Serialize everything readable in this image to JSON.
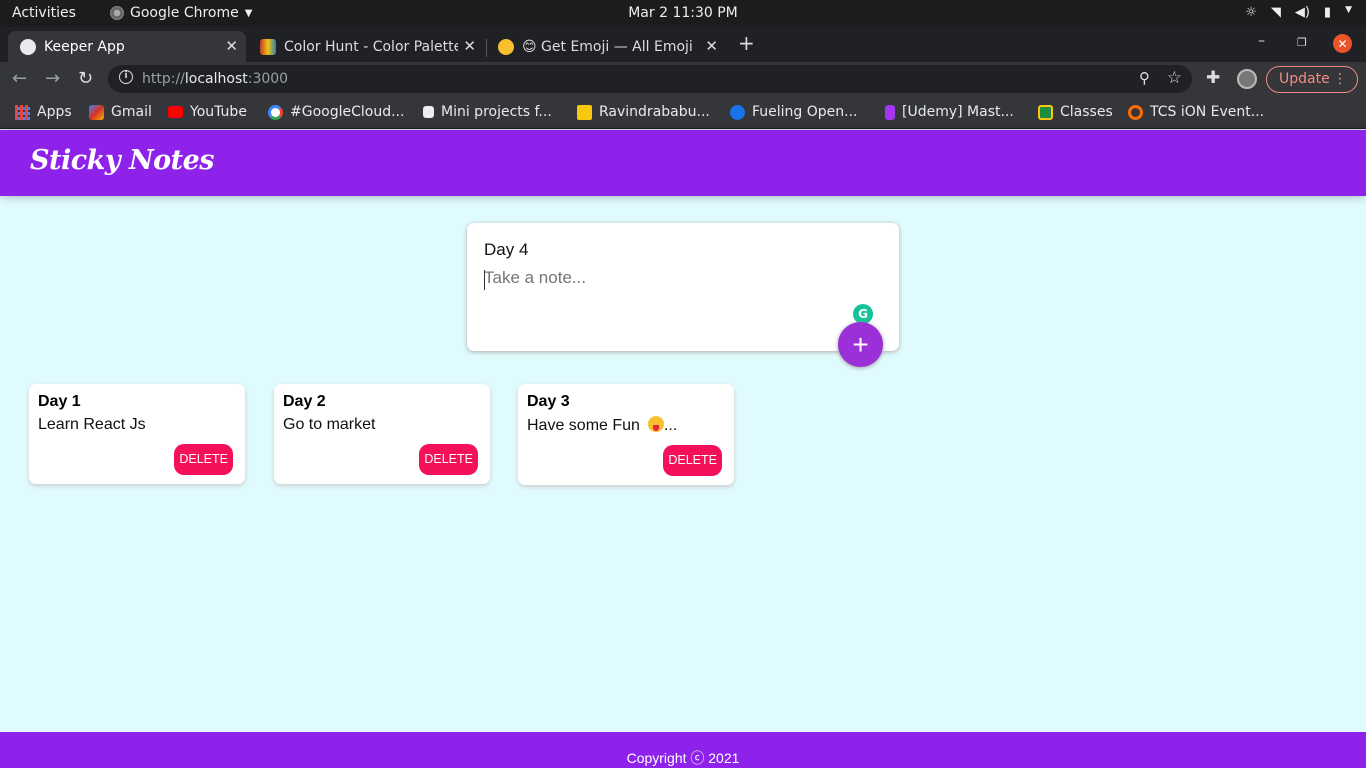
{
  "system": {
    "activities": "Activities",
    "app_name": "Google Chrome",
    "clock": "Mar 2  11:30 PM"
  },
  "tabs": [
    {
      "label": "Keeper App",
      "active": true
    },
    {
      "label": "Color Hunt - Color Palette",
      "active": false
    },
    {
      "label": "😊 Get Emoji — All Emojis",
      "active": false
    }
  ],
  "omnibox": {
    "url_prefix": "http://",
    "url_host": "localhost",
    "url_port": ":3000"
  },
  "update_label": "Update",
  "bookmarks": [
    {
      "label": "Apps",
      "color": "#e8453c"
    },
    {
      "label": "Gmail",
      "color": "#d93025"
    },
    {
      "label": "YouTube",
      "color": "#ff0000"
    },
    {
      "label": "#GoogleCloud...",
      "color": "#4285f4"
    },
    {
      "label": "Mini projects f...",
      "color": "#ffffff"
    },
    {
      "label": "Ravindrababu...",
      "color": "#f9c80e"
    },
    {
      "label": "Fueling Open...",
      "color": "#1a73e8"
    },
    {
      "label": "[Udemy] Mast...",
      "color": "#a435f0"
    },
    {
      "label": "Classes",
      "color": "#1e8e3e"
    },
    {
      "label": "TCS iON Event...",
      "color": "#ff6d00"
    }
  ],
  "app": {
    "title": "Sticky Notes",
    "accent": "#8f22ea",
    "create": {
      "title_value": "Day 4",
      "content_placeholder": "Take a note...",
      "add_label": "+"
    },
    "notes": [
      {
        "title": "Day 1",
        "content": "Learn React Js",
        "delete_label": "DELETE"
      },
      {
        "title": "Day 2",
        "content": "Go to market",
        "delete_label": "DELETE"
      },
      {
        "title": "Day 3",
        "content": "Have some Fun",
        "suffix": "...",
        "delete_label": "DELETE"
      }
    ],
    "footer": "Copyright ⓒ 2021"
  }
}
